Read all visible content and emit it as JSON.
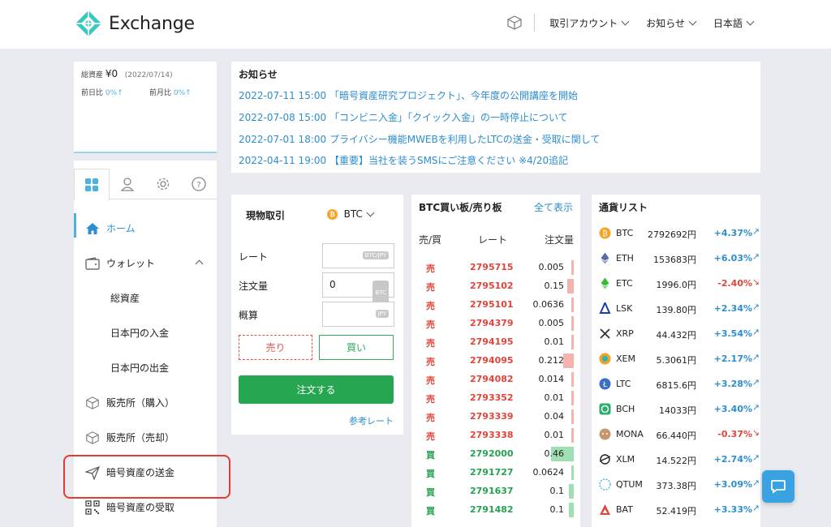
{
  "header": {
    "brand": "Exchange",
    "nav": [
      "取引アカウント",
      "お知らせ",
      "日本語"
    ]
  },
  "assets": {
    "total_label": "総資産",
    "total_value": "¥0",
    "date": "(2022/07/14)",
    "prev_day_label": "前日比",
    "prev_day_value": "0%↑",
    "prev_month_label": "前月比",
    "prev_month_value": "0%↑"
  },
  "sidebar": {
    "items": [
      {
        "label": "ホーム",
        "icon": "home-icon"
      },
      {
        "label": "ウォレット",
        "icon": "wallet-icon"
      },
      {
        "label": "総資産"
      },
      {
        "label": "日本円の入金"
      },
      {
        "label": "日本円の出金"
      },
      {
        "label": "販売所（購入）",
        "icon": "cube-icon"
      },
      {
        "label": "販売所（売却）",
        "icon": "cube-icon"
      },
      {
        "label": "暗号資産の送金",
        "icon": "send-icon"
      },
      {
        "label": "暗号資産の受取",
        "icon": "qr-icon"
      }
    ]
  },
  "news": {
    "title": "お知らせ",
    "items": [
      "2022-07-11 15:00 「暗号資産研究プロジェクト」、今年度の公開講座を開始",
      "2022-07-08 15:00 「コンビニ入金」「クイック入金」の一時停止について",
      "2022-07-01 18:00 プライバシー機能MWEBを利用したLTCの送金・受取に関して",
      "2022-04-11 19:00 【重要】当社を装うSMSにご注意ください ※4/20追記"
    ]
  },
  "spot": {
    "title": "現物取引",
    "coin": "BTC",
    "rate_label": "レート",
    "rate_unit": "BTC/JPY",
    "qty_label": "注文量",
    "qty_value": "0",
    "qty_unit": "BTC",
    "est_label": "概算",
    "est_unit": "JPY",
    "sell": "売り",
    "buy": "買い",
    "order": "注文する",
    "ref": "参考レート"
  },
  "book": {
    "title": "BTC買い板/売り板",
    "show_all": "全て表示",
    "col_side": "売/買",
    "col_rate": "レート",
    "col_amount": "注文量",
    "rows": [
      {
        "side": "売",
        "rate": "2795715",
        "amount": "0.005",
        "depth": 0.02
      },
      {
        "side": "売",
        "rate": "2795102",
        "amount": "0.15",
        "depth": 0.3
      },
      {
        "side": "売",
        "rate": "2795101",
        "amount": "0.0636",
        "depth": 0.1
      },
      {
        "side": "売",
        "rate": "2794379",
        "amount": "0.005",
        "depth": 0.02
      },
      {
        "side": "売",
        "rate": "2794195",
        "amount": "0.01",
        "depth": 0.03
      },
      {
        "side": "売",
        "rate": "2794095",
        "amount": "0.212",
        "depth": 0.45
      },
      {
        "side": "売",
        "rate": "2794082",
        "amount": "0.014",
        "depth": 0.04
      },
      {
        "side": "売",
        "rate": "2793352",
        "amount": "0.01",
        "depth": 0.03
      },
      {
        "side": "売",
        "rate": "2793339",
        "amount": "0.04",
        "depth": 0.08
      },
      {
        "side": "売",
        "rate": "2793338",
        "amount": "0.01",
        "depth": 0.03
      },
      {
        "side": "買",
        "rate": "2792000",
        "amount": "0.46",
        "depth": 1.0
      },
      {
        "side": "買",
        "rate": "2791727",
        "amount": "0.0624",
        "depth": 0.12
      },
      {
        "side": "買",
        "rate": "2791637",
        "amount": "0.1",
        "depth": 0.2
      },
      {
        "side": "買",
        "rate": "2791482",
        "amount": "0.1",
        "depth": 0.2
      }
    ]
  },
  "coins": {
    "title": "通貨リスト",
    "rows": [
      {
        "sym": "BTC",
        "price": "2792692円",
        "chg": "+4.37%",
        "dir": "up",
        "icon": "btc-icon",
        "color": "#f7a325"
      },
      {
        "sym": "ETH",
        "price": "153683円",
        "chg": "+6.03%",
        "dir": "up",
        "icon": "eth-icon",
        "color": "#5a6aa8"
      },
      {
        "sym": "ETC",
        "price": "1996.0円",
        "chg": "-2.40%",
        "dir": "down",
        "icon": "etc-icon",
        "color": "#3ab83a"
      },
      {
        "sym": "LSK",
        "price": "139.80円",
        "chg": "+2.34%",
        "dir": "up",
        "icon": "lsk-icon",
        "color": "#1a3fa0"
      },
      {
        "sym": "XRP",
        "price": "44.432円",
        "chg": "+3.54%",
        "dir": "up",
        "icon": "xrp-icon",
        "color": "#333333"
      },
      {
        "sym": "XEM",
        "price": "5.3061円",
        "chg": "+2.17%",
        "dir": "up",
        "icon": "xem-icon",
        "color": "#f2a31b"
      },
      {
        "sym": "LTC",
        "price": "6815.6円",
        "chg": "+3.28%",
        "dir": "up",
        "icon": "ltc-icon",
        "color": "#3b6fc5"
      },
      {
        "sym": "BCH",
        "price": "14033円",
        "chg": "+3.40%",
        "dir": "up",
        "icon": "bch-icon",
        "color": "#2aaf6c"
      },
      {
        "sym": "MONA",
        "price": "66.440円",
        "chg": "-0.37%",
        "dir": "down",
        "icon": "mona-icon",
        "color": "#c49a6c"
      },
      {
        "sym": "XLM",
        "price": "14.522円",
        "chg": "+2.74%",
        "dir": "up",
        "icon": "xlm-icon",
        "color": "#222222"
      },
      {
        "sym": "QTUM",
        "price": "373.38円",
        "chg": "+3.09%",
        "dir": "up",
        "icon": "qtum-icon",
        "color": "#4ab3e0"
      },
      {
        "sym": "BAT",
        "price": "52.419円",
        "chg": "+3.33%",
        "dir": "up",
        "icon": "bat-icon",
        "color": "#e2443a"
      }
    ]
  },
  "colors": {
    "accent": "#2d8ecf",
    "sell": "#e2443a",
    "buy": "#24a34f",
    "highlight": "#e53a2f"
  }
}
